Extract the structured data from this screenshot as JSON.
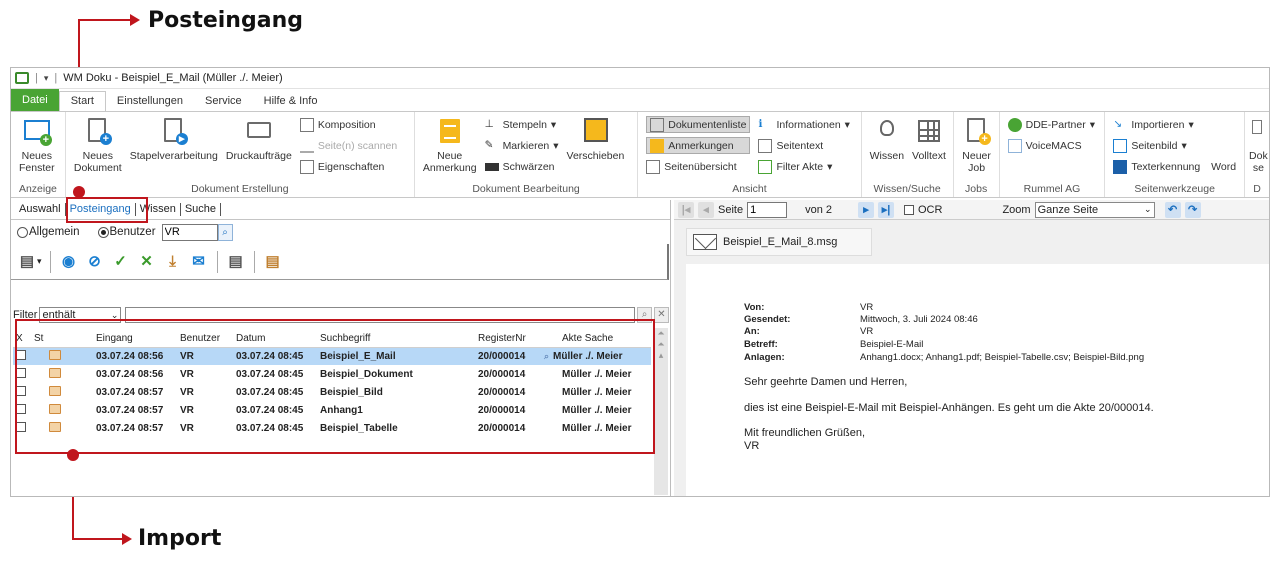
{
  "callouts": {
    "top": "Posteingang",
    "bottom": "Import"
  },
  "window": {
    "title": "WM Doku - Beispiel_E_Mail (Müller ./. Meier)"
  },
  "ribbon_tabs": [
    "Datei",
    "Start",
    "Einstellungen",
    "Service",
    "Hilfe & Info"
  ],
  "ribbon": {
    "anzeige": {
      "label": "Anzeige",
      "neues_fenster": "Neues\nFenster"
    },
    "erstellung": {
      "label": "Dokument Erstellung",
      "neues_dokument": "Neues\nDokument",
      "stapel": "Stapelverarbeitung",
      "druck": "Druckaufträge",
      "komposition": "Komposition",
      "scannen": "Seite(n) scannen",
      "eigenschaften": "Eigenschaften"
    },
    "bearbeitung": {
      "label": "Dokument Bearbeitung",
      "neue_anmerkung": "Neue\nAnmerkung",
      "stempeln": "Stempeln",
      "markieren": "Markieren",
      "schwaerzen": "Schwärzen",
      "verschieben": "Verschieben"
    },
    "ansicht": {
      "label": "Ansicht",
      "dokumentenliste": "Dokumentenliste",
      "anmerkungen": "Anmerkungen",
      "seitenuebersicht": "Seitenübersicht",
      "informationen": "Informationen",
      "seitentext": "Seitentext",
      "filter_akte": "Filter Akte"
    },
    "wissen": {
      "label": "Wissen/Suche",
      "wissen": "Wissen",
      "volltext": "Volltext"
    },
    "jobs": {
      "label": "Jobs",
      "neuer_job": "Neuer\nJob"
    },
    "rummel": {
      "label": "Rummel AG",
      "dde": "DDE-Partner",
      "voicemacs": "VoiceMACS"
    },
    "seitenwerkzeuge": {
      "label": "Seitenwerkzeuge",
      "importieren": "Importieren",
      "seitenbild": "Seitenbild",
      "texterkennung": "Texterkennung",
      "word": "Word"
    },
    "extra": {
      "label": "D",
      "dok": "Dok\nse"
    }
  },
  "left_tabs": [
    "Auswahl",
    "Posteingang",
    "Wissen",
    "Suche"
  ],
  "filter_options": {
    "allgemein": "Allgemein",
    "benutzer": "Benutzer",
    "benutzer_value": "VR"
  },
  "filter": {
    "label": "Filter",
    "mode": "enthält"
  },
  "table": {
    "headers": [
      "X",
      "St",
      "Eingang",
      "Benutzer",
      "Datum",
      "Suchbegriff",
      "RegisterNr",
      "Akte Sache"
    ],
    "rows": [
      [
        "03.07.24 08:56",
        "VR",
        "03.07.24 08:45",
        "Beispiel_E_Mail",
        "20/000014",
        "Müller ./. Meier"
      ],
      [
        "03.07.24 08:56",
        "VR",
        "03.07.24 08:45",
        "Beispiel_Dokument",
        "20/000014",
        "Müller ./. Meier"
      ],
      [
        "03.07.24 08:57",
        "VR",
        "03.07.24 08:45",
        "Beispiel_Bild",
        "20/000014",
        "Müller ./. Meier"
      ],
      [
        "03.07.24 08:57",
        "VR",
        "03.07.24 08:45",
        "Anhang1",
        "20/000014",
        "Müller ./. Meier"
      ],
      [
        "03.07.24 08:57",
        "VR",
        "03.07.24 08:45",
        "Beispiel_Tabelle",
        "20/000014",
        "Müller ./. Meier"
      ]
    ]
  },
  "viewer": {
    "seite_label": "Seite",
    "seite_value": "1",
    "von": "von 2",
    "ocr": "OCR",
    "zoom_label": "Zoom",
    "zoom_value": "Ganze Seite",
    "attachment": "Beispiel_E_Mail_8.msg"
  },
  "mail": {
    "von_label": "Von:",
    "von": "VR",
    "gesendet_label": "Gesendet:",
    "gesendet": "Mittwoch, 3. Juli 2024 08:46",
    "an_label": "An:",
    "an": "VR",
    "betreff_label": "Betreff:",
    "betreff": "Beispiel-E-Mail",
    "anlagen_label": "Anlagen:",
    "anlagen": "Anhang1.docx; Anhang1.pdf; Beispiel-Tabelle.csv; Beispiel-Bild.png",
    "greeting": "Sehr geehrte Damen und Herren,",
    "body": "dies ist eine Beispiel-E-Mail mit Beispiel-Anhängen. Es geht um die Akte 20/000014.",
    "closing": "Mit freundlichen Grüßen,",
    "signature": "VR"
  },
  "colors": {
    "accent_red": "#c0161d",
    "ribbon_green": "#49a434",
    "selection": "#b7d8f7"
  }
}
